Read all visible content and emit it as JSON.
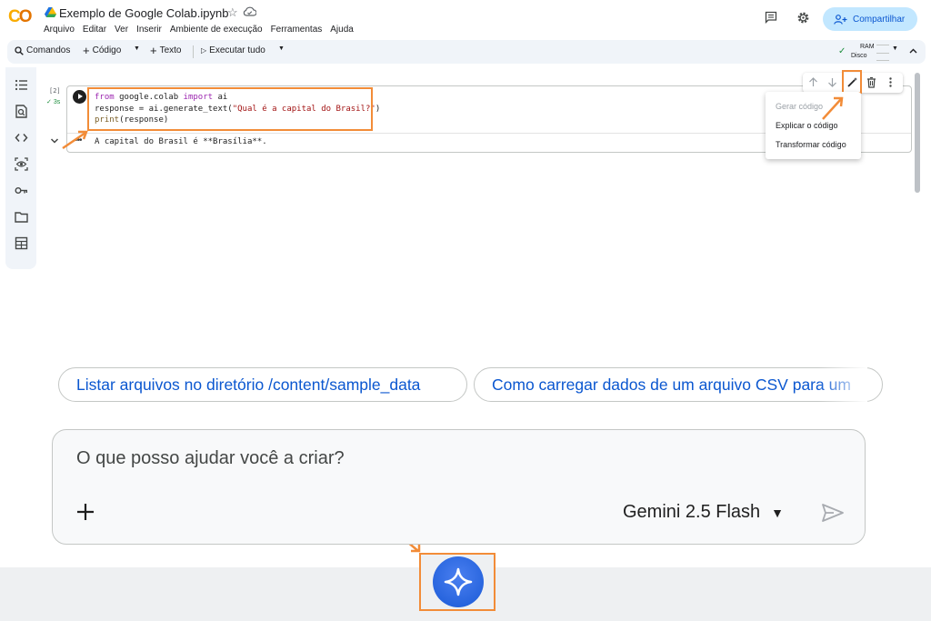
{
  "header": {
    "logo_text": "CO",
    "title": "Exemplo de Google Colab.ipynb",
    "share_label": "Compartilhar",
    "menu": [
      "Arquivo",
      "Editar",
      "Ver",
      "Inserir",
      "Ambiente de execução",
      "Ferramentas",
      "Ajuda"
    ]
  },
  "toolbar": {
    "commands_label": "Comandos",
    "code_label": "Código",
    "text_label": "Texto",
    "run_all_label": "Executar tudo",
    "ram_label": "RAM",
    "disk_label": "Disco"
  },
  "cell": {
    "exec_count": "[2]",
    "exec_time": "3s",
    "code_lines": [
      {
        "parts": [
          [
            "kw",
            "from"
          ],
          [
            "t",
            " google.colab "
          ],
          [
            "kw",
            "import"
          ],
          [
            "t",
            " ai"
          ]
        ]
      },
      {
        "parts": [
          [
            "t",
            "response = ai.generate_text("
          ],
          [
            "str",
            "\"Qual é a capital do Brasil?\""
          ],
          [
            "t",
            ")"
          ]
        ]
      },
      {
        "parts": [
          [
            "fn",
            "print"
          ],
          [
            "t",
            "(response)"
          ]
        ]
      }
    ],
    "output": "A capital do Brasil é **Brasília**."
  },
  "context_menu": {
    "items": [
      {
        "label": "Gerar código",
        "disabled": true
      },
      {
        "label": "Explicar o código",
        "disabled": false
      },
      {
        "label": "Transformar código",
        "disabled": false
      }
    ]
  },
  "suggestions": [
    "Listar arquivos no diretório /content/sample_data",
    "Como carregar dados de um arquivo CSV para um"
  ],
  "prompt": {
    "placeholder": "O que posso ajudar você a criar?",
    "model": "Gemini 2.5 Flash"
  },
  "colors": {
    "accent": "#0b57d0",
    "highlight": "#f28c38",
    "gemini": "#1a5ad6"
  }
}
